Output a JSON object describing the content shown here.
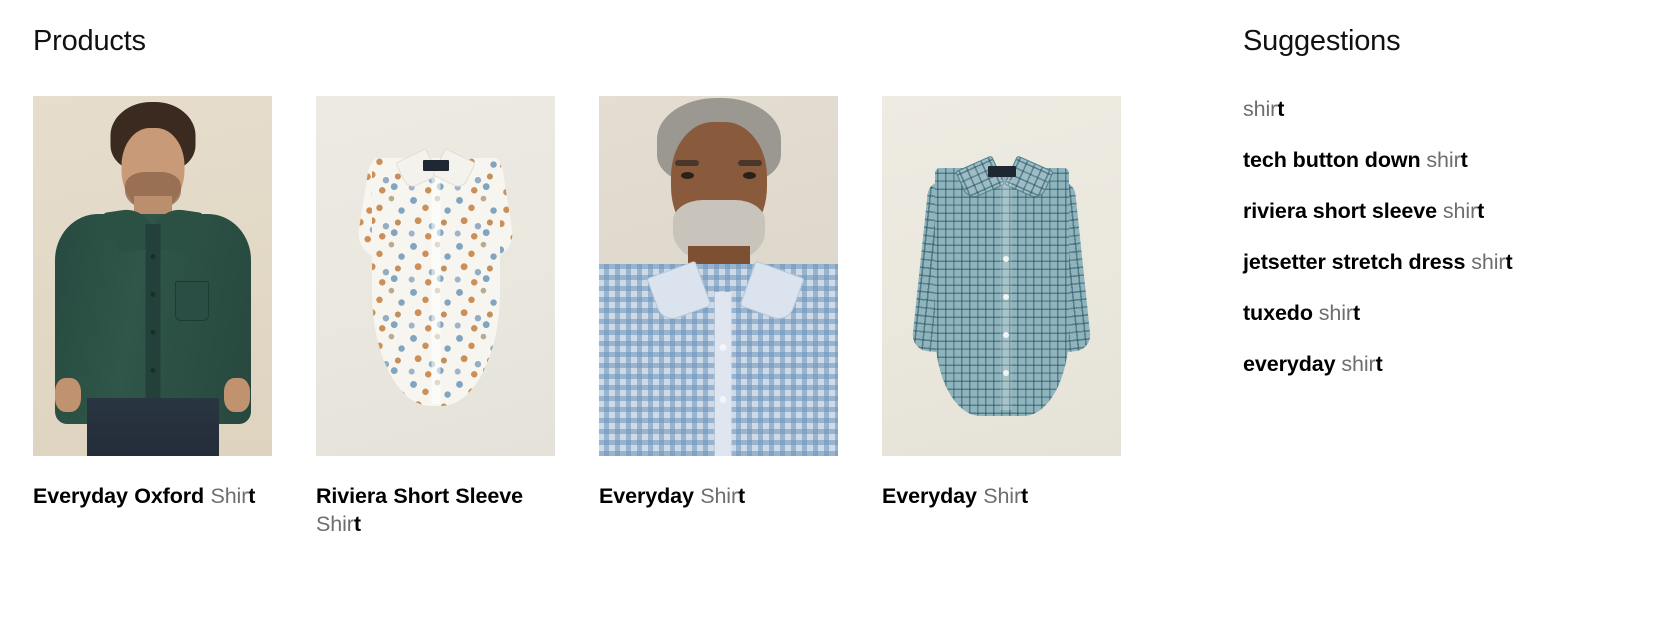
{
  "products": {
    "heading": "Products",
    "items": [
      {
        "title_parts": [
          {
            "text": "Everyday Oxford ",
            "match": true
          },
          {
            "text": "Shir",
            "match": false
          },
          {
            "text": "t",
            "match": true
          }
        ],
        "title_plain": "Everyday Oxford Shirt",
        "image_alt": "Model wearing dark green Everyday Oxford Shirt",
        "image_bg": "#e3d9c7",
        "garment_color": "#2f5648"
      },
      {
        "title_parts": [
          {
            "text": "Riviera Short Sleeve ",
            "match": true
          },
          {
            "text": "Shir",
            "match": false
          },
          {
            "text": "t",
            "match": true
          }
        ],
        "title_plain": "Riviera Short Sleeve Shirt",
        "image_alt": "Floral print Riviera Short Sleeve Shirt flat lay",
        "image_bg": "#e9e7de",
        "garment_color": "#f7f5f0"
      },
      {
        "title_parts": [
          {
            "text": "Everyday ",
            "match": true
          },
          {
            "text": "Shir",
            "match": false
          },
          {
            "text": "t",
            "match": true
          }
        ],
        "title_plain": "Everyday Shirt",
        "image_alt": "Model wearing blue gingham Everyday Shirt",
        "image_bg": "#ded7cb",
        "garment_color": "#cfdae8"
      },
      {
        "title_parts": [
          {
            "text": "Everyday ",
            "match": true
          },
          {
            "text": "Shir",
            "match": false
          },
          {
            "text": "t",
            "match": true
          }
        ],
        "title_plain": "Everyday Shirt",
        "image_alt": "Teal check Everyday Shirt flat lay",
        "image_bg": "#eae7dd",
        "garment_color": "#8fb4bd"
      }
    ]
  },
  "suggestions": {
    "heading": "Suggestions",
    "items": [
      {
        "plain": "shirt",
        "parts": [
          {
            "text": "shir",
            "match": false
          },
          {
            "text": "t",
            "match": true
          }
        ]
      },
      {
        "plain": "tech button down shirt",
        "parts": [
          {
            "text": "tech button down ",
            "match": true
          },
          {
            "text": "shir",
            "match": false
          },
          {
            "text": "t",
            "match": true
          }
        ]
      },
      {
        "plain": "riviera short sleeve shirt",
        "parts": [
          {
            "text": "riviera short sleeve ",
            "match": true
          },
          {
            "text": "shir",
            "match": false
          },
          {
            "text": "t",
            "match": true
          }
        ]
      },
      {
        "plain": "jetsetter stretch dress shirt",
        "parts": [
          {
            "text": "jetsetter stretch dress ",
            "match": true
          },
          {
            "text": "shir",
            "match": false
          },
          {
            "text": "t",
            "match": true
          }
        ]
      },
      {
        "plain": "tuxedo shirt",
        "parts": [
          {
            "text": "tuxedo ",
            "match": true
          },
          {
            "text": "shir",
            "match": false
          },
          {
            "text": "t",
            "match": true
          }
        ]
      },
      {
        "plain": "everyday shirt",
        "parts": [
          {
            "text": "everyday ",
            "match": true
          },
          {
            "text": "shir",
            "match": false
          },
          {
            "text": "t",
            "match": true
          }
        ]
      }
    ]
  },
  "colors": {
    "background": "#ffffff",
    "text_strong": "#000000",
    "text_dim": "#6e6e6e",
    "heading": "#111111"
  }
}
